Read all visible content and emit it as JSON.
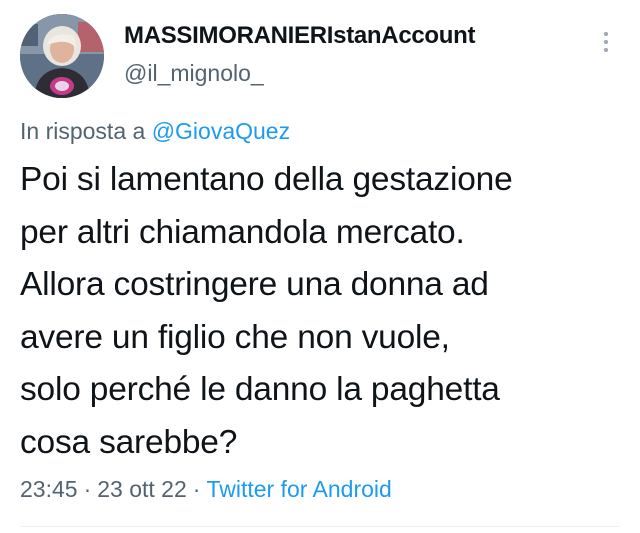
{
  "author": {
    "display_name": "MASSIMORANIERIstanAccount",
    "handle": "@il_mignolo_",
    "avatar_icon": "profile-photo"
  },
  "reply": {
    "prefix": "In risposta a",
    "mention": "@GiovaQuez"
  },
  "tweet": {
    "lines": [
      "Poi si lamentano della gestazione",
      "per altri chiamandola mercato.",
      "Allora costringere una donna ad",
      "avere un figlio che non vuole,",
      "solo perché le danno la paghetta",
      "cosa sarebbe?"
    ]
  },
  "meta": {
    "time": "23:45",
    "date": "23 ott 22",
    "separator": "·",
    "source": "Twitter for Android"
  },
  "colors": {
    "link": "#1d9bf0",
    "secondary_text": "#536471",
    "primary_text": "#0f1419"
  }
}
